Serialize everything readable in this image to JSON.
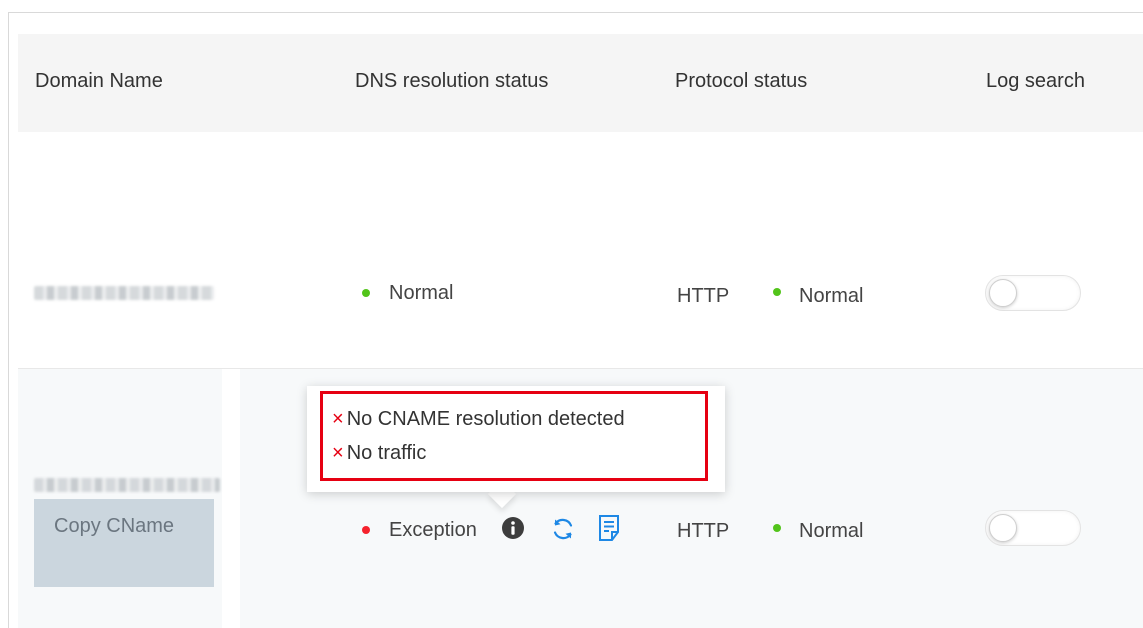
{
  "table": {
    "columns": {
      "domain_name": "Domain Name",
      "dns_status": "DNS resolution status",
      "protocol_status": "Protocol status",
      "log_search": "Log search"
    },
    "rows": [
      {
        "domain": "",
        "dns_status": "Normal",
        "protocol": "HTTP",
        "protocol_status": "Normal",
        "log_search_enabled": false
      },
      {
        "domain": "",
        "copy_button": "Copy CName",
        "dns_status": "Exception",
        "protocol": "HTTP",
        "protocol_status": "Normal",
        "log_search_enabled": false
      }
    ]
  },
  "tooltip": {
    "lines": [
      "No CNAME resolution detected",
      "No traffic"
    ],
    "error_mark": "×"
  },
  "colors": {
    "normal": "#52c41a",
    "exception": "#f5222d",
    "highlight_box": "#e60012",
    "action_icon": "#1e88e5",
    "header_bg": "#f5f5f5"
  },
  "icons": [
    "info-icon",
    "refresh-icon",
    "document-icon"
  ]
}
